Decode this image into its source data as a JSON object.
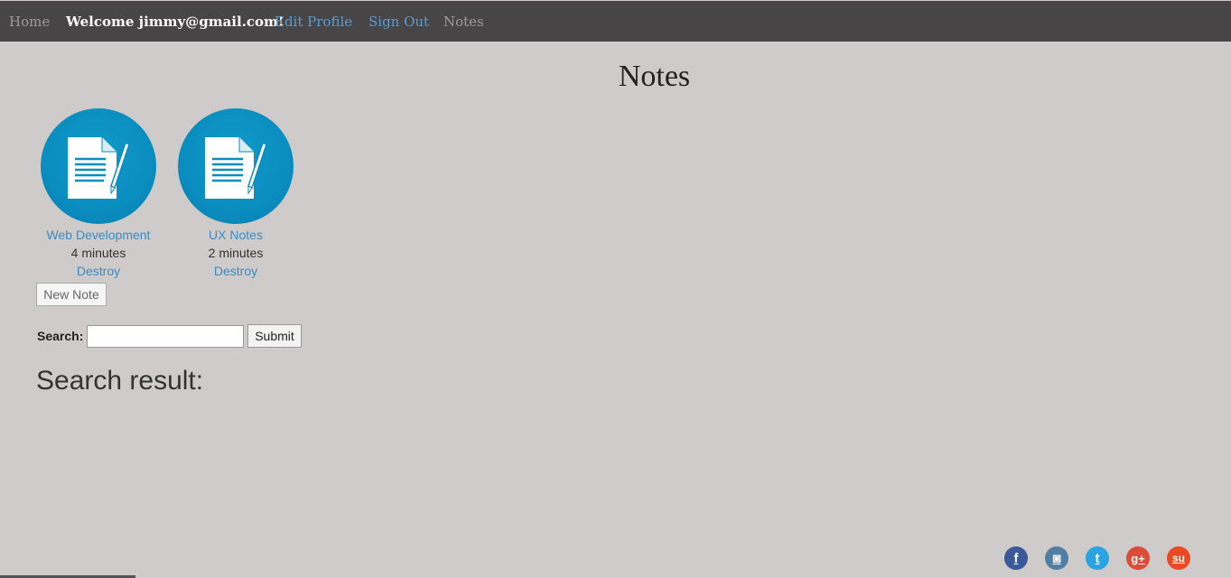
{
  "nav": {
    "home": "Home",
    "welcome": "Welcome jimmy@gmail.com!",
    "edit_profile": "Edit Profile",
    "sign_out": "Sign Out",
    "notes": "Notes"
  },
  "page": {
    "title": "Notes"
  },
  "notes": [
    {
      "title": "Web Development",
      "time": "4 minutes",
      "destroy": "Destroy"
    },
    {
      "title": "UX Notes",
      "time": "2 minutes",
      "destroy": "Destroy"
    }
  ],
  "new_note_label": "New Note",
  "search": {
    "label": "Search:",
    "value": "",
    "submit_label": "Submit",
    "result_heading": "Search result:"
  },
  "social": [
    {
      "icon": "facebook-icon",
      "glyph": "f",
      "color": "#3b5998"
    },
    {
      "icon": "instagram-icon",
      "glyph": "◙",
      "color": "#517fa4"
    },
    {
      "icon": "twitter-icon",
      "glyph": "t",
      "color": "#2aa3e0"
    },
    {
      "icon": "google-plus-icon",
      "glyph": "g+",
      "color": "#dd4b39"
    },
    {
      "icon": "stumbleupon-icon",
      "glyph": "su",
      "color": "#eb4924"
    }
  ],
  "colors": {
    "navbar_bg": "#474546",
    "page_bg": "#cfcbca",
    "link": "#3a8cc4",
    "note_icon": "#0a8dbf"
  }
}
